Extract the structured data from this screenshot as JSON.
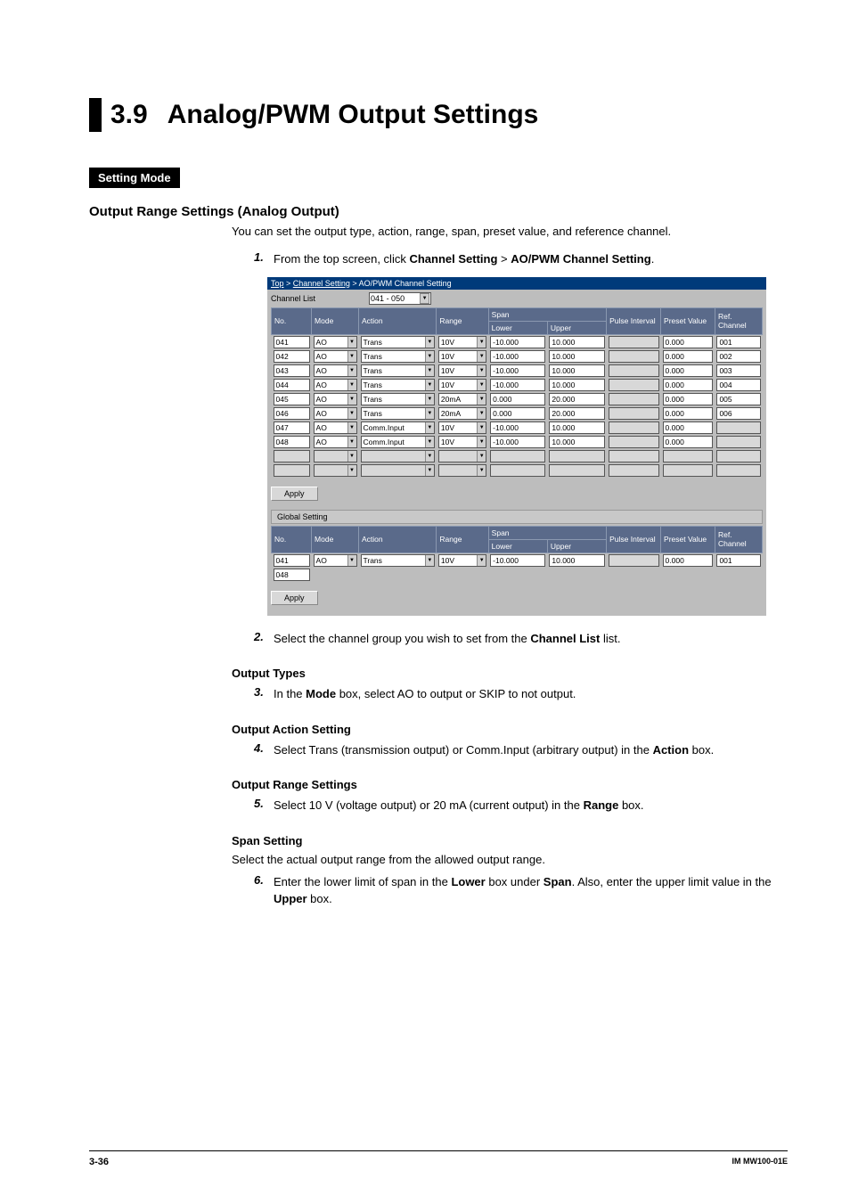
{
  "chapter": {
    "num": "3.9",
    "title": "Analog/PWM Output Settings"
  },
  "settingModeBadge": "Setting Mode",
  "section1": {
    "heading": "Output Range Settings (Analog Output)",
    "intro": "You can set the output type, action, range, span, preset value, and reference channel."
  },
  "steps": {
    "s1": {
      "num": "1.",
      "prefix": "From the top screen, click ",
      "b1": "Channel Setting",
      "mid": " > ",
      "b2": "AO/PWM Channel Setting",
      "suffix": "."
    },
    "s2": {
      "num": "2.",
      "prefix": "Select the channel group you wish to set from the ",
      "b1": "Channel List",
      "suffix": " list."
    },
    "s3": {
      "num": "3.",
      "prefix": "In the ",
      "b1": "Mode",
      "suffix": " box, select AO to output or SKIP to not output."
    },
    "s4": {
      "num": "4.",
      "prefix": "Select Trans (transmission output) or Comm.Input (arbitrary output) in the ",
      "b1": "Action",
      "suffix": " box."
    },
    "s5": {
      "num": "5.",
      "prefix": "Select 10 V (voltage output) or 20 mA (current output) in the ",
      "b1": "Range",
      "suffix": " box."
    },
    "s6": {
      "num": "6.",
      "p1": "Enter the lower limit of span in the ",
      "b1": "Lower",
      "p2": " box under ",
      "b2": "Span",
      "p3": ". Also, enter the upper limit value in the ",
      "b3": "Upper",
      "p4": " box."
    }
  },
  "subheads": {
    "outputTypes": "Output Types",
    "outputAction": "Output Action Setting",
    "outputRange": "Output Range Settings",
    "spanSetting": "Span Setting",
    "spanIntro": "Select the actual output range from the allowed output range."
  },
  "screenshot": {
    "breadcrumb": {
      "top": "Top",
      "cs": "Channel Setting",
      "tail": "AO/PWM Channel Setting"
    },
    "channelListLabel": "Channel List",
    "channelListValue": "041 - 050",
    "headers": {
      "no": "No.",
      "mode": "Mode",
      "action": "Action",
      "range": "Range",
      "span": "Span",
      "lower": "Lower",
      "upper": "Upper",
      "pulse": "Pulse Interval",
      "preset": "Preset Value",
      "ref": "Ref. Channel"
    },
    "rows": [
      {
        "no": "041",
        "mode": "AO",
        "action": "Trans",
        "range": "10V",
        "lower": "-10.000",
        "upper": "10.000",
        "pulse": "",
        "preset": "0.000",
        "ref": "001"
      },
      {
        "no": "042",
        "mode": "AO",
        "action": "Trans",
        "range": "10V",
        "lower": "-10.000",
        "upper": "10.000",
        "pulse": "",
        "preset": "0.000",
        "ref": "002"
      },
      {
        "no": "043",
        "mode": "AO",
        "action": "Trans",
        "range": "10V",
        "lower": "-10.000",
        "upper": "10.000",
        "pulse": "",
        "preset": "0.000",
        "ref": "003"
      },
      {
        "no": "044",
        "mode": "AO",
        "action": "Trans",
        "range": "10V",
        "lower": "-10.000",
        "upper": "10.000",
        "pulse": "",
        "preset": "0.000",
        "ref": "004"
      },
      {
        "no": "045",
        "mode": "AO",
        "action": "Trans",
        "range": "20mA",
        "lower": "0.000",
        "upper": "20.000",
        "pulse": "",
        "preset": "0.000",
        "ref": "005"
      },
      {
        "no": "046",
        "mode": "AO",
        "action": "Trans",
        "range": "20mA",
        "lower": "0.000",
        "upper": "20.000",
        "pulse": "",
        "preset": "0.000",
        "ref": "006"
      },
      {
        "no": "047",
        "mode": "AO",
        "action": "Comm.Input",
        "range": "10V",
        "lower": "-10.000",
        "upper": "10.000",
        "pulse": "",
        "preset": "0.000",
        "ref": ""
      },
      {
        "no": "048",
        "mode": "AO",
        "action": "Comm.Input",
        "range": "10V",
        "lower": "-10.000",
        "upper": "10.000",
        "pulse": "",
        "preset": "0.000",
        "ref": ""
      },
      {
        "no": "",
        "mode": "",
        "action": "",
        "range": "",
        "lower": "",
        "upper": "",
        "pulse": "",
        "preset": "",
        "ref": "",
        "disabled": true
      },
      {
        "no": "",
        "mode": "",
        "action": "",
        "range": "",
        "lower": "",
        "upper": "",
        "pulse": "",
        "preset": "",
        "ref": "",
        "disabled": true
      }
    ],
    "applyLabel": "Apply",
    "globalSettingLabel": "Global Setting",
    "globalRows": [
      {
        "no": "041",
        "mode": "AO",
        "action": "Trans",
        "range": "10V",
        "lower": "-10.000",
        "upper": "10.000",
        "pulse": "",
        "preset": "0.000",
        "ref": "001"
      },
      {
        "no": "048",
        "mode": "",
        "action": "",
        "range": "",
        "lower": "",
        "upper": "",
        "pulse": "",
        "preset": "",
        "ref": ""
      }
    ]
  },
  "footer": {
    "page": "3-36",
    "doc": "IM MW100-01E"
  }
}
